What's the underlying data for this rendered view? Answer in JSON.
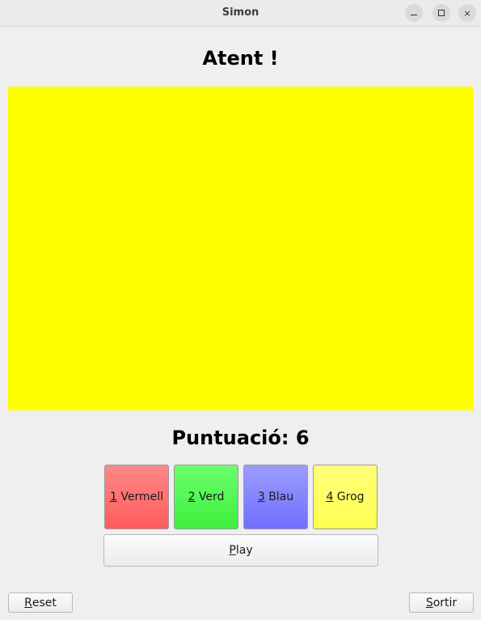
{
  "window": {
    "title": "Simon",
    "controls": {
      "minimize": "minimize",
      "maximize": "maximize",
      "close": "close"
    }
  },
  "status": "Atent !",
  "display": {
    "color": "#ffff00"
  },
  "score": "Puntuació: 6",
  "color_buttons": [
    {
      "mnemonic": "1",
      "label": " Vermell",
      "color": "#ff6f6f"
    },
    {
      "mnemonic": "2",
      "label": " Verd",
      "color": "#50f850"
    },
    {
      "mnemonic": "3",
      "label": " Blau",
      "color": "#8585ff"
    },
    {
      "mnemonic": "4",
      "label": " Grog",
      "color": "#ffff66"
    }
  ],
  "play_button": {
    "mnemonic": "P",
    "rest": "lay"
  },
  "reset_button": {
    "mnemonic": "R",
    "rest": "eset"
  },
  "exit_button": {
    "mnemonic": "S",
    "rest": "ortir"
  },
  "icons": {
    "close": "×"
  }
}
